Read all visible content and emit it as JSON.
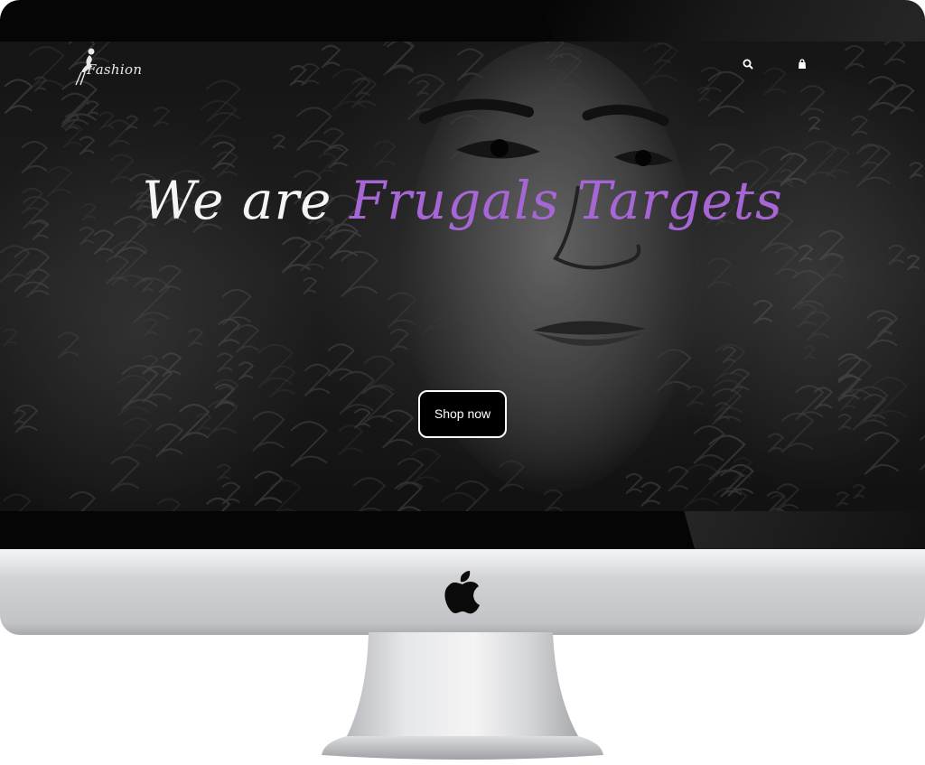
{
  "site": {
    "logo_text": "Fashion",
    "logo_icon": "fashion-woman-silhouette-icon",
    "nav": {
      "search_icon": "search-icon",
      "cart_icon": "shopping-bag-icon"
    }
  },
  "hero": {
    "headline_white": "We are",
    "headline_accent": "Frugals Targets",
    "button_label": "Shop now"
  },
  "device": {
    "brand_icon": "apple-logo-icon"
  },
  "colors": {
    "accent": "#a766d6",
    "button_bg": "#000000",
    "button_border": "#ffffff",
    "bezel": "#050505",
    "chin": "#cfd0d3"
  }
}
